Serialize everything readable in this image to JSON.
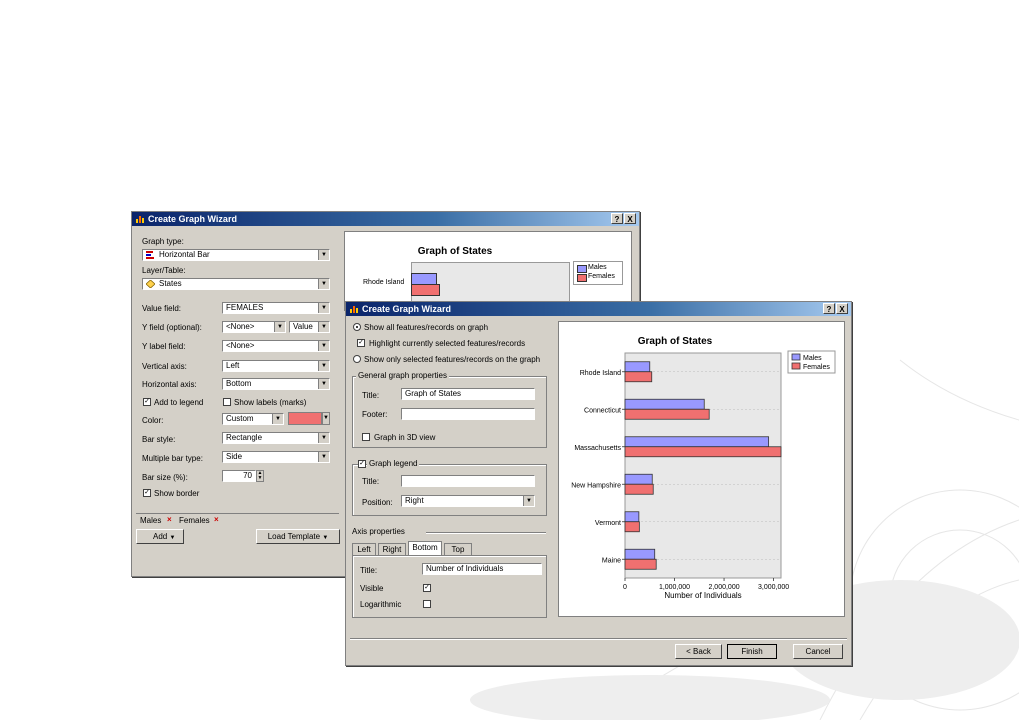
{
  "colors": {
    "males": "#9999ff",
    "females": "#f07070",
    "titlebar": "#0a246a",
    "dialog": "#d4d0c8"
  },
  "back_window": {
    "title": "Create Graph Wizard",
    "help_btn": "?",
    "close_btn": "X",
    "graph_type_label": "Graph type:",
    "graph_type_value": "Horizontal Bar",
    "layer_label": "Layer/Table:",
    "layer_value": "States",
    "value_field_label": "Value field:",
    "value_field_value": "FEMALES",
    "yfield_label": "Y field (optional):",
    "yfield_value": "<None>",
    "yfield_mode": "Value",
    "ylabel_label": "Y label field:",
    "ylabel_value": "<None>",
    "vaxis_label": "Vertical axis:",
    "vaxis_value": "Left",
    "haxis_label": "Horizontal axis:",
    "haxis_value": "Bottom",
    "add_legend_label": "Add to legend",
    "show_labels_label": "Show labels (marks)",
    "color_label": "Color:",
    "color_value": "Custom",
    "bar_style_label": "Bar style:",
    "bar_style_value": "Rectangle",
    "multi_bar_label": "Multiple bar type:",
    "multi_bar_value": "Side",
    "bar_size_label": "Bar size (%):",
    "bar_size_value": "70",
    "show_border_label": "Show border",
    "series_tab_1": "Males",
    "series_tab_2": "Females",
    "add_btn": "Add",
    "load_template_btn": "Load Template",
    "chart_title": "Graph of States",
    "chart_first_category": "Rhode Island",
    "legend_males": "Males",
    "legend_females": "Females"
  },
  "front_window": {
    "title": "Create Graph Wizard",
    "help_btn": "?",
    "close_btn": "X",
    "opt_show_all": "Show all features/records on graph",
    "opt_highlight": "Highlight currently selected features/records",
    "opt_show_selected": "Show only selected features/records on the graph",
    "general_group": "General graph properties",
    "title_label": "Title:",
    "title_value": "Graph of States",
    "footer_label": "Footer:",
    "footer_value": "",
    "graph3d_label": "Graph in 3D view",
    "legend_group": "Graph legend",
    "legend_title_label": "Title:",
    "legend_title_value": "",
    "position_label": "Position:",
    "position_value": "Right",
    "axis_group": "Axis properties",
    "tabs": [
      "Left",
      "Right",
      "Bottom",
      "Top"
    ],
    "axis_title_label": "Title:",
    "axis_title_value": "Number of Individuals",
    "visible_label": "Visible",
    "log_label": "Logarithmic",
    "back_btn": "< Back",
    "finish_btn": "Finish",
    "cancel_btn": "Cancel"
  },
  "chart_data": {
    "type": "bar",
    "orientation": "horizontal",
    "title": "Graph of States",
    "xlabel": "Number of Individuals",
    "ylabel": "",
    "categories": [
      "Rhode Island",
      "Connecticut",
      "Massachusetts",
      "New Hampshire",
      "Vermont",
      "Maine"
    ],
    "series": [
      {
        "name": "Males",
        "values": [
          500000,
          1600000,
          2900000,
          550000,
          280000,
          600000
        ]
      },
      {
        "name": "Females",
        "values": [
          540000,
          1700000,
          3150000,
          570000,
          290000,
          630000
        ]
      }
    ],
    "xlim": [
      0,
      3150000
    ],
    "xticks": [
      0,
      1000000,
      2000000,
      3000000
    ],
    "xtick_labels": [
      "0",
      "1,000,000",
      "2,000,000",
      "3,000,000"
    ],
    "legend": [
      "Males",
      "Females"
    ],
    "legend_position": "right",
    "grid": true
  }
}
